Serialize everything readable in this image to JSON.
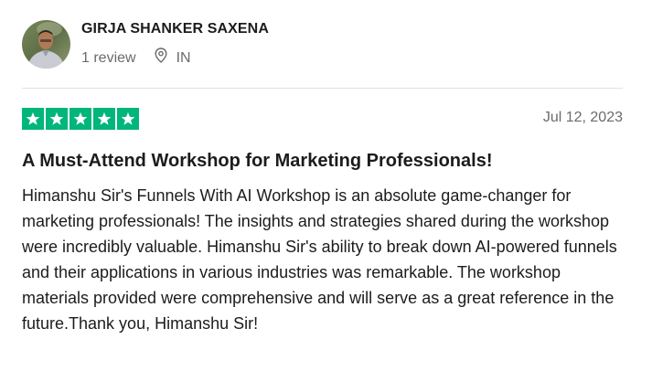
{
  "reviewer": {
    "name": "GIRJA SHANKER SAXENA",
    "review_count": "1 review",
    "country": "IN",
    "avatar_icon": "profile-photo"
  },
  "review": {
    "rating": 5,
    "rating_max": 5,
    "star_color": "#00b67a",
    "date": "Jul 12, 2023",
    "title": "A Must-Attend Workshop for Marketing Professionals!",
    "body": "Himanshu Sir's Funnels With AI Workshop is an absolute game-changer for marketing professionals! The insights and strategies shared during the workshop were incredibly valuable. Himanshu Sir's ability to break down AI-powered funnels and their applications in various industries was remarkable. The workshop materials provided were comprehensive and will serve as a great reference in the future.Thank you, Himanshu Sir!"
  },
  "icons": {
    "location": "location-pin-icon",
    "star": "star-icon"
  }
}
